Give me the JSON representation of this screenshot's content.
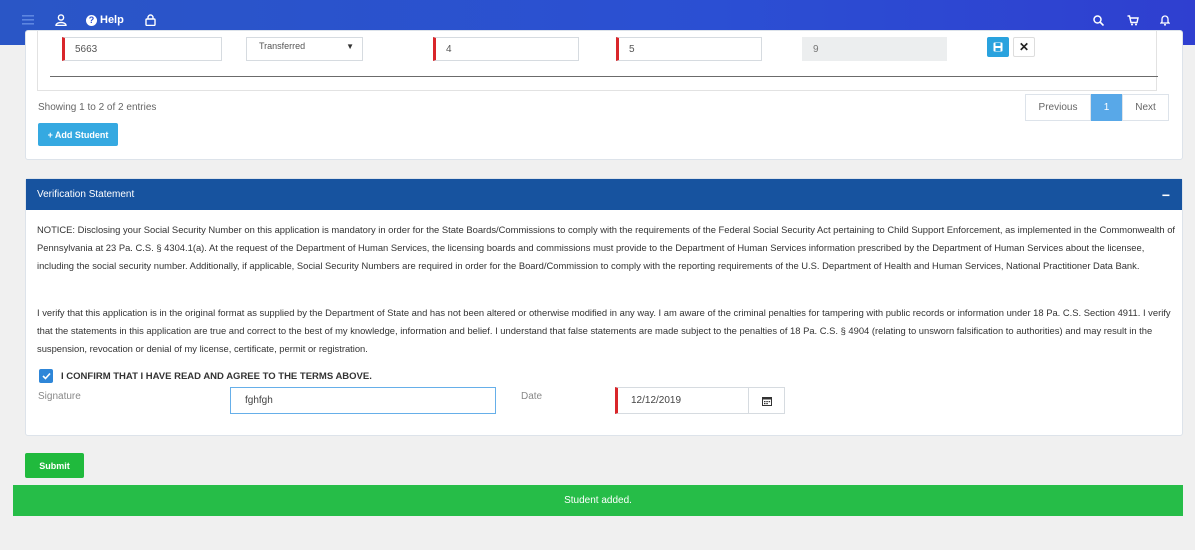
{
  "navbar": {
    "help_label": "Help",
    "icons": [
      "menu-icon",
      "user-icon",
      "help-circle-icon",
      "lock-icon",
      "search-icon",
      "cart-icon",
      "bell-icon"
    ]
  },
  "student_row": {
    "field1": "5663",
    "status": "Transferred",
    "field3": "4",
    "field4": "5",
    "field5": "9"
  },
  "table_footer": {
    "showing": "Showing 1 to 2 of 2 entries",
    "previous": "Previous",
    "page": "1",
    "next": "Next",
    "add_student": "Add Student"
  },
  "verification": {
    "header": "Verification Statement",
    "collapse_symbol": "−",
    "notice": "NOTICE: Disclosing your Social Security Number on this application is mandatory in order for the State Boards/Commissions to comply with the requirements of the Federal Social Security Act pertaining to Child Support Enforcement, as implemented in the Commonwealth of Pennsylvania at 23 Pa. C.S. § 4304.1(a). At the request of the Department of Human Services, the licensing boards and commissions must provide to the Department of Human Services information prescribed by the Department of Human Services about the licensee, including the social security number. Additionally, if applicable, Social Security Numbers are required in order for the Board/Commission to comply with the reporting requirements of the U.S. Department of Health and Human Services, National Practitioner Data Bank.",
    "verify": "I verify that this application is in the original format as supplied by the Department of State and has not been altered or otherwise modified in any way. I am aware of the criminal penalties for tampering with public records or information under 18 Pa. C.S. Section 4911. I verify that the statements in this application are true and correct to the best of my knowledge, information and belief. I understand that false statements are made subject to the penalties of 18 Pa. C.S. § 4904 (relating to unsworn falsification to authorities) and may result in the suspension, revocation or denial of my license, certificate, permit or registration.",
    "confirm_label": "I CONFIRM THAT I HAVE READ AND AGREE TO THE TERMS ABOVE.",
    "confirmed": true,
    "signature_label": "Signature",
    "signature_value": "fghfgh",
    "date_label": "Date",
    "date_value": "12/12/2019"
  },
  "actions": {
    "submit": "Submit"
  },
  "toast": {
    "message": "Student added."
  },
  "colors": {
    "navbar": "#2a56c6",
    "card_header": "#17539f",
    "success": "#26bd48",
    "info_button": "#35a9e1",
    "required_marker": "#d9262a"
  }
}
